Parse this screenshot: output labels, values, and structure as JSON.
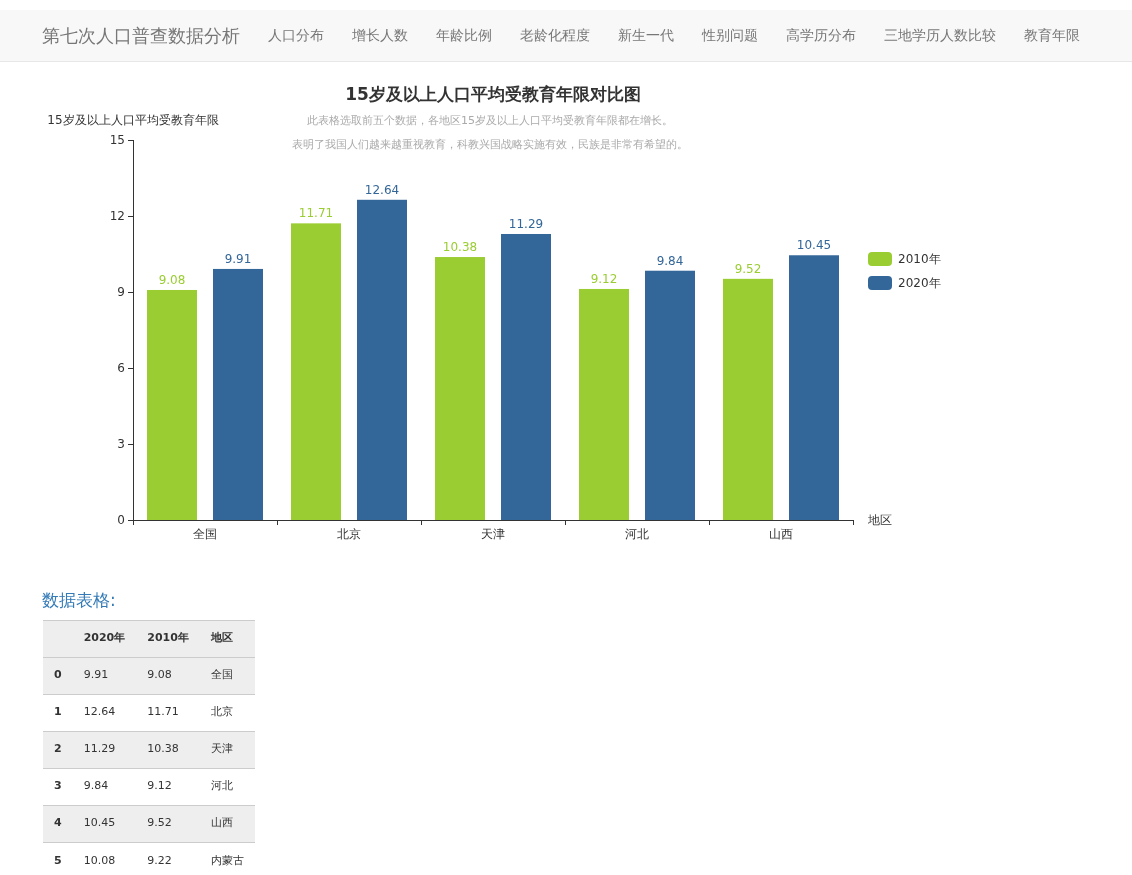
{
  "navbar": {
    "brand": "第七次人口普查数据分析",
    "items": [
      {
        "label": "人口分布",
        "selected": false
      },
      {
        "label": "增长人数",
        "selected": false
      },
      {
        "label": "年龄比例",
        "selected": false
      },
      {
        "label": "老龄化程度",
        "selected": false
      },
      {
        "label": "新生一代",
        "selected": false
      },
      {
        "label": "性别问题",
        "selected": false
      },
      {
        "label": "高学历分布",
        "selected": false
      },
      {
        "label": "三地学历人数比较",
        "selected": false
      },
      {
        "label": "教育年限",
        "selected": false
      }
    ]
  },
  "chart": {
    "subtitle": [
      "此表格选取前五个数据，各地区15岁及以上人口平均受教育年限都在增长。",
      "表明了我国人们越来越重视教育，科教兴国战略实施有效，民族是非常有希望的。"
    ],
    "chart_data": {
      "type": "bar",
      "title": "15岁及以上人口平均受教育年限对比图",
      "xlabel": "地区",
      "ylabel": "15岁及以上人口平均受教育年限",
      "categories": [
        "全国",
        "北京",
        "天津",
        "河北",
        "山西"
      ],
      "series": [
        {
          "name": "2010年",
          "color": "#9acd32",
          "values": [
            9.08,
            11.71,
            10.38,
            9.12,
            9.52
          ]
        },
        {
          "name": "2020年",
          "color": "#336699",
          "values": [
            9.91,
            12.64,
            11.29,
            9.84,
            10.45
          ]
        }
      ],
      "legend": "right",
      "ylim": [
        0,
        15
      ],
      "yticks": [
        0,
        3,
        6,
        9,
        12,
        15
      ],
      "data_labels": true,
      "value_labels": [
        [
          "9.08",
          "11.71",
          "10.38",
          "9.12",
          "9.52"
        ],
        [
          "9.91",
          "12.64",
          "11.29",
          "9.84",
          "10.45"
        ]
      ]
    }
  },
  "table": {
    "heading": "数据表格:",
    "columns": [
      "",
      "2020年",
      "2010年",
      "地区"
    ],
    "rows": [
      [
        "0",
        "9.91",
        "9.08",
        "全国"
      ],
      [
        "1",
        "12.64",
        "11.71",
        "北京"
      ],
      [
        "2",
        "11.29",
        "10.38",
        "天津"
      ],
      [
        "3",
        "9.84",
        "9.12",
        "河北"
      ],
      [
        "4",
        "10.45",
        "9.52",
        "山西"
      ],
      [
        "5",
        "10.08",
        "9.22",
        "内蒙古"
      ]
    ]
  }
}
